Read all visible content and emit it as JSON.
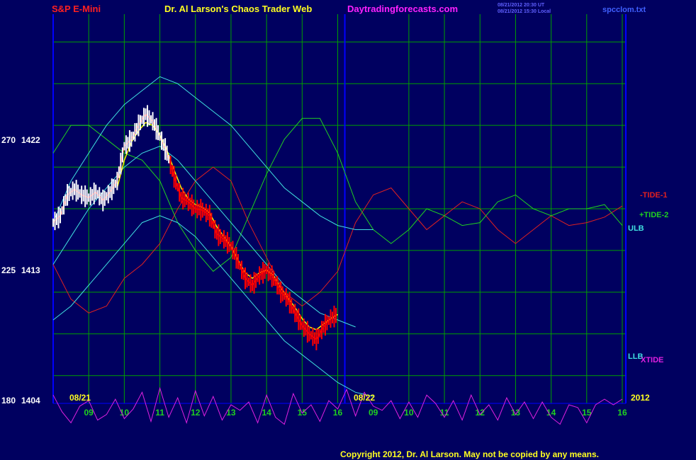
{
  "header": {
    "instrument": "S&P E-Mini",
    "title": "Dr. Al Larson's Chaos Trader Web",
    "website": "Daytradingforecasts.com",
    "timestamp1": "08/21/2012 20:30 UT",
    "timestamp2": "08/21/2012 15:30 Local",
    "filename": "spcclom.txt"
  },
  "footer": {
    "copyright": "Copyright 2012, Dr. Al Larson. May not be copied by any means."
  },
  "colors": {
    "background": "#000060",
    "grid": "#00A000",
    "axis": "#0000FF",
    "title_red": "#FF2020",
    "title_yellow": "#FFFF20",
    "magenta": "#FF20FF",
    "tide1": "#E02020",
    "tide2": "#20D020",
    "cyan": "#40E0E0",
    "xtide": "#E020E0",
    "price_red": "#FF0000",
    "price_white": "#FFFFFF",
    "yellow_ma": "#FFFF00"
  },
  "chart_data": {
    "type": "line",
    "title": "S&P E-Mini",
    "y_axis": {
      "ticks": [
        {
          "left": "270",
          "right": "1422",
          "value": 1422
        },
        {
          "left": "225",
          "right": "1413",
          "value": 1413
        },
        {
          "left": "180",
          "right": "1404",
          "value": 1404
        }
      ],
      "ylim": [
        1404,
        1432
      ]
    },
    "x_axis": {
      "day_labels": [
        "08/21",
        "08/22",
        "2012"
      ],
      "hour_ticks": [
        "09",
        "10",
        "11",
        "12",
        "13",
        "14",
        "15",
        "16",
        "09",
        "10",
        "11",
        "12",
        "13",
        "14",
        "15",
        "16"
      ],
      "xlim": [
        8.0,
        24.1
      ]
    },
    "series": [
      {
        "name": "-TIDE-1",
        "color_key": "tide1",
        "x": [
          8.0,
          8.5,
          9.0,
          9.5,
          10.0,
          10.5,
          11.0,
          11.5,
          12.0,
          12.5,
          13.0,
          13.5,
          14.0,
          14.5,
          15.0,
          15.5,
          16.0,
          16.5,
          17.0,
          17.5,
          18.0,
          18.5,
          19.0,
          19.5,
          20.0,
          20.5,
          21.0,
          21.5,
          22.0,
          22.5,
          23.0,
          23.5,
          24.0
        ],
        "y": [
          1414.0,
          1411.5,
          1410.5,
          1411.0,
          1413.0,
          1414.0,
          1415.5,
          1418.0,
          1420.0,
          1421.0,
          1420.0,
          1417.0,
          1414.5,
          1412.0,
          1411.0,
          1412.0,
          1413.5,
          1417.0,
          1419.0,
          1419.5,
          1418.0,
          1416.5,
          1417.5,
          1418.5,
          1418.0,
          1416.5,
          1415.5,
          1416.5,
          1417.5,
          1416.8,
          1417.0,
          1417.4,
          1418.2
        ]
      },
      {
        "name": "+TIDE-2",
        "color_key": "tide2",
        "x": [
          8.0,
          8.5,
          9.0,
          9.5,
          10.0,
          10.5,
          11.0,
          11.5,
          12.0,
          12.5,
          13.0,
          13.5,
          14.0,
          14.5,
          15.0,
          15.5,
          16.0,
          16.5,
          17.0,
          17.5,
          18.0,
          18.5,
          19.0,
          19.5,
          20.0,
          20.5,
          21.0,
          21.5,
          22.0,
          22.5,
          23.0,
          23.5,
          24.0
        ],
        "y": [
          1422.0,
          1424.0,
          1424.0,
          1423.0,
          1422.0,
          1421.5,
          1420.0,
          1417.0,
          1415.0,
          1413.5,
          1414.5,
          1417.5,
          1420.5,
          1423.0,
          1424.5,
          1424.5,
          1422.0,
          1418.5,
          1416.5,
          1415.5,
          1416.5,
          1418.0,
          1417.5,
          1416.8,
          1417.0,
          1418.5,
          1419.0,
          1418.0,
          1417.5,
          1418.0,
          1418.0,
          1418.3,
          1416.8
        ]
      },
      {
        "name": "ULB",
        "color_key": "cyan",
        "x": [
          8.0,
          8.5,
          9.0,
          9.5,
          10.0,
          10.5,
          11.0,
          11.5,
          12.0,
          12.5,
          13.0,
          13.5,
          14.0,
          14.5,
          15.0,
          15.5,
          16.0,
          16.5,
          17.0
        ],
        "y": [
          1417.0,
          1420.0,
          1422.0,
          1424.0,
          1425.5,
          1426.5,
          1427.5,
          1427.0,
          1426.0,
          1425.0,
          1424.0,
          1422.5,
          1421.0,
          1419.5,
          1418.5,
          1417.5,
          1416.8,
          1416.5,
          1416.5
        ]
      },
      {
        "name": "Mid band",
        "color_key": "cyan",
        "x": [
          8.0,
          8.5,
          9.0,
          9.5,
          10.0,
          10.5,
          11.0,
          11.5,
          12.0,
          12.5,
          13.0,
          13.5,
          14.0,
          14.5,
          15.0,
          15.5,
          16.0,
          16.5
        ],
        "y": [
          1414.0,
          1416.0,
          1418.0,
          1419.5,
          1421.0,
          1422.0,
          1422.5,
          1421.5,
          1420.0,
          1418.5,
          1417.0,
          1415.5,
          1414.0,
          1412.5,
          1411.5,
          1410.5,
          1410.0,
          1409.5
        ]
      },
      {
        "name": "LLB",
        "color_key": "cyan",
        "x": [
          8.0,
          8.5,
          9.0,
          9.5,
          10.0,
          10.5,
          11.0,
          11.5,
          12.0,
          12.5,
          13.0,
          13.5,
          14.0,
          14.5,
          15.0,
          15.5,
          16.0,
          16.5,
          17.0
        ],
        "y": [
          1410.0,
          1411.0,
          1412.5,
          1414.0,
          1415.5,
          1417.0,
          1417.5,
          1417.0,
          1416.0,
          1414.5,
          1413.0,
          1411.5,
          1410.0,
          1408.5,
          1407.5,
          1406.5,
          1405.5,
          1404.8,
          1404.5
        ]
      },
      {
        "name": "XTIDE",
        "color_key": "xtide",
        "x": [
          8.0,
          8.25,
          8.5,
          8.75,
          9.0,
          9.25,
          9.5,
          9.75,
          10.0,
          10.25,
          10.5,
          10.75,
          11.0,
          11.25,
          11.5,
          11.75,
          12.0,
          12.25,
          12.5,
          12.75,
          13.0,
          13.25,
          13.5,
          13.75,
          14.0,
          14.25,
          14.5,
          14.75,
          15.0,
          15.25,
          15.5,
          15.75,
          16.0,
          16.25,
          16.5,
          16.75,
          17.0,
          17.25,
          17.5,
          17.75,
          18.0,
          18.25,
          18.5,
          18.75,
          19.0,
          19.25,
          19.5,
          19.75,
          20.0,
          20.25,
          20.5,
          20.75,
          21.0,
          21.25,
          21.5,
          21.75,
          22.0,
          22.25,
          22.5,
          22.75,
          23.0,
          23.25,
          23.5,
          23.75,
          24.0
        ],
        "y": [
          1404.6,
          1403.4,
          1402.6,
          1403.8,
          1404.2,
          1402.8,
          1403.2,
          1404.3,
          1402.9,
          1403.6,
          1404.8,
          1402.7,
          1405.1,
          1403.0,
          1404.4,
          1402.6,
          1404.9,
          1403.1,
          1404.5,
          1402.8,
          1403.9,
          1403.5,
          1404.1,
          1402.6,
          1404.6,
          1403.0,
          1402.5,
          1404.7,
          1403.3,
          1403.9,
          1402.7,
          1404.2,
          1403.6,
          1405.0,
          1403.1,
          1404.8,
          1403.8,
          1403.5,
          1404.2,
          1402.9,
          1404.1,
          1403.0,
          1404.6,
          1404.0,
          1403.0,
          1404.2,
          1402.8,
          1404.6,
          1403.2,
          1403.9,
          1402.8,
          1404.4,
          1403.2,
          1404.1,
          1402.9,
          1404.1,
          1403.0,
          1402.5,
          1403.9,
          1403.7,
          1402.6,
          1403.9,
          1404.3,
          1403.9,
          1404.3
        ]
      },
      {
        "name": "Price",
        "color_key": "price_red",
        "x": [
          8.0,
          8.2,
          8.4,
          8.6,
          8.8,
          9.0,
          9.2,
          9.4,
          9.6,
          9.8,
          10.0,
          10.2,
          10.4,
          10.6,
          10.8,
          11.0,
          11.2,
          11.4,
          11.6,
          11.8,
          12.0,
          12.2,
          12.4,
          12.6,
          12.8,
          13.0,
          13.2,
          13.4,
          13.6,
          13.8,
          14.0,
          14.2,
          14.4,
          14.6,
          14.8,
          15.0,
          15.2,
          15.4,
          15.6,
          15.8,
          16.0
        ],
        "y": [
          1417.0,
          1417.5,
          1419.0,
          1419.4,
          1419.0,
          1418.8,
          1419.2,
          1418.6,
          1419.2,
          1420.0,
          1422.5,
          1423.0,
          1424.0,
          1424.8,
          1424.3,
          1423.2,
          1422.0,
          1420.3,
          1418.8,
          1418.5,
          1418.0,
          1417.9,
          1417.5,
          1416.2,
          1415.8,
          1415.3,
          1414.2,
          1413.0,
          1412.5,
          1413.2,
          1413.6,
          1413.0,
          1412.0,
          1411.5,
          1410.5,
          1409.6,
          1409.0,
          1408.6,
          1409.5,
          1410.1,
          1410.4
        ]
      },
      {
        "name": "Moving avg",
        "color_key": "yellow_ma",
        "x": [
          9.8,
          10.0,
          10.2,
          10.4,
          10.6,
          10.8,
          11.0,
          11.2,
          11.4,
          11.6,
          11.8,
          12.0,
          12.2,
          12.4,
          12.6,
          12.8,
          13.0,
          13.2,
          13.4,
          13.6,
          13.8,
          14.0,
          14.2,
          14.4,
          14.6,
          14.8,
          15.0,
          15.2,
          15.4,
          15.6,
          15.8,
          16.0
        ],
        "y": [
          1419.5,
          1421.5,
          1422.8,
          1423.6,
          1424.2,
          1424.0,
          1423.3,
          1422.2,
          1420.8,
          1419.5,
          1418.7,
          1418.3,
          1418.1,
          1417.7,
          1416.7,
          1416.0,
          1415.3,
          1414.3,
          1413.4,
          1413.0,
          1413.4,
          1413.6,
          1413.2,
          1412.3,
          1411.6,
          1410.9,
          1410.1,
          1409.5,
          1409.3,
          1409.7,
          1410.1,
          1410.4
        ]
      }
    ],
    "labels": {
      "tide1": "-TIDE-1",
      "tide2": "+TIDE-2",
      "ulb": "ULB",
      "llb": "LLB",
      "xtide": "XTIDE"
    },
    "grid": true
  }
}
